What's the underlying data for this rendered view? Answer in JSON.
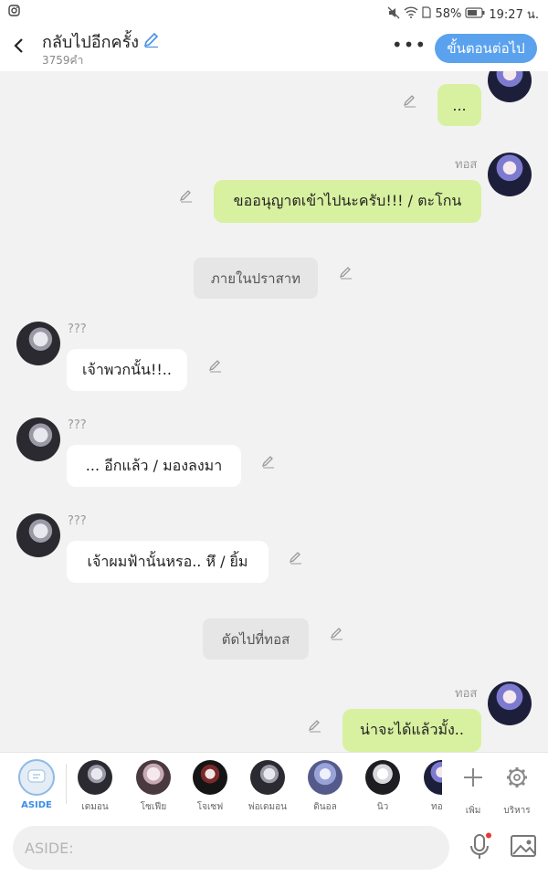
{
  "status_bar": {
    "left_icon": "instagram-icon",
    "battery": "58%",
    "time": "19:27 น."
  },
  "header": {
    "title": "กลับไปอีกครั้ง",
    "subtitle": "3759คำ",
    "next_button": "ขั้นตอนต่อไป",
    "more_label": "•••"
  },
  "messages": [
    {
      "kind": "right",
      "text": "..."
    },
    {
      "kind": "right",
      "name": "ทอส",
      "text": "ขออนุญาตเข้าไปนะครับ!!! / ตะโกน"
    },
    {
      "kind": "narration",
      "text": "ภายในปราสาท"
    },
    {
      "kind": "left",
      "name": "???",
      "text": "เจ้าพวกนั้น!!.."
    },
    {
      "kind": "left",
      "name": "???",
      "text": "... อีกแล้ว / มองลงมา"
    },
    {
      "kind": "left",
      "name": "???",
      "text": "เจ้าผมฟ้านั้นหรอ.. หึ / ยิ้ม"
    },
    {
      "kind": "narration",
      "text": "ตัดไปที่ทอส"
    },
    {
      "kind": "right",
      "name": "ทอส",
      "text": "น่าจะได้แล้วมั้ง.."
    }
  ],
  "characters": {
    "aside_label": "ASIDE",
    "list": [
      {
        "name": "เดมอน"
      },
      {
        "name": "โซเฟีย"
      },
      {
        "name": "โจเซฟ"
      },
      {
        "name": "พ่อเดมอน"
      },
      {
        "name": "ดินอล"
      },
      {
        "name": "นิว"
      },
      {
        "name": "ทอ"
      }
    ],
    "add_label": "เพิ่ม",
    "manage_label": "บริหาร"
  },
  "input": {
    "placeholder": "ASIDE:"
  },
  "colors": {
    "accent": "#5aa2ee",
    "player_bubble": "#d8f1a0",
    "other_bubble": "#ffffff",
    "narration_bubble": "#e6e6e6"
  }
}
